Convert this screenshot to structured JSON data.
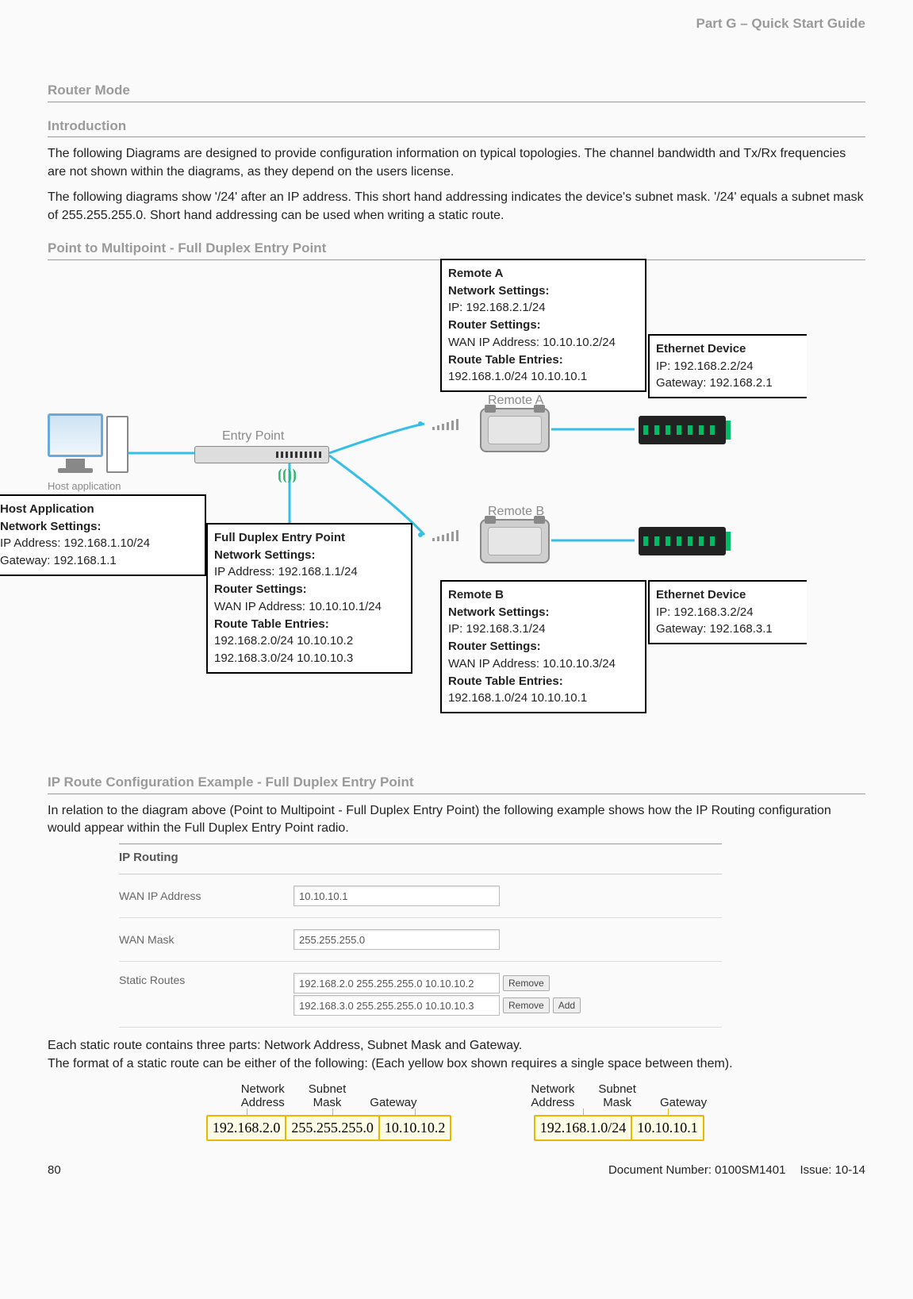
{
  "header": {
    "partLabel": "Part G – Quick Start Guide"
  },
  "sections": {
    "routerMode": "Router Mode",
    "intro": "Introduction",
    "ptmp": "Point to Multipoint - Full Duplex Entry Point",
    "ipcfg": "IP Route Configuration Example - Full Duplex Entry Point"
  },
  "paragraphs": {
    "p1": "The following Diagrams are designed to provide configuration information on typical topologies. The channel bandwidth and Tx/Rx frequencies are not shown within the diagrams, as they depend on the users license.",
    "p2": "The following diagrams show '/24' after an IP address. This short hand addressing indicates the device's subnet mask. '/24' equals a subnet mask of 255.255.255.0. Short hand addressing can be used when writing a static route.",
    "p3": "In relation to the diagram above (Point to Multipoint - Full Duplex Entry Point) the following example shows how the IP Routing configuration would appear within the Full Duplex Entry Point radio.",
    "p4a": "Each static route contains three parts: Network Address, Subnet Mask and Gateway.",
    "p4b": "The format of a static route can be either of the following: (Each yellow box shown requires a single space between them)."
  },
  "diagram": {
    "hostApp": {
      "title": "Host Application",
      "subtitle": "Network Settings:",
      "ip": "IP Address: 192.168.1.10/24",
      "gw": "Gateway: 192.168.1.1",
      "iconLabel": "Host application"
    },
    "entryPoint": {
      "label": "Entry Point",
      "boxTitle": "Full Duplex Entry Point",
      "ns": "Network Settings:",
      "ip": "IP Address: 192.168.1.1/24",
      "rs": "Router Settings:",
      "wan": "WAN IP Address: 10.10.10.1/24",
      "rte": "Route Table Entries:",
      "r1": "192.168.2.0/24 10.10.10.2",
      "r2": "192.168.3.0/24 10.10.10.3"
    },
    "remoteA": {
      "label": "Remote A",
      "title": "Remote A",
      "ns": "Network Settings:",
      "ip": "IP: 192.168.2.1/24",
      "rs": "Router Settings:",
      "wan": "WAN IP Address: 10.10.10.2/24",
      "rte": "Route Table Entries:",
      "r1": "192.168.1.0/24 10.10.10.1"
    },
    "remoteB": {
      "label": "Remote B",
      "title": "Remote B",
      "ns": "Network Settings:",
      "ip": "IP: 192.168.3.1/24",
      "rs": "Router Settings:",
      "wan": "WAN IP Address: 10.10.10.3/24",
      "rte": "Route Table Entries:",
      "r1": "192.168.1.0/24 10.10.10.1"
    },
    "ethA": {
      "title": "Ethernet Device",
      "ip": "IP: 192.168.2.2/24",
      "gw": "Gateway: 192.168.2.1"
    },
    "ethB": {
      "title": "Ethernet Device",
      "ip": "IP: 192.168.3.2/24",
      "gw": "Gateway: 192.168.3.1"
    }
  },
  "ipRouting": {
    "panelTitle": "IP Routing",
    "wanIpLabel": "WAN IP Address",
    "wanIpValue": "10.10.10.1",
    "wanMaskLabel": "WAN Mask",
    "wanMaskValue": "255.255.255.0",
    "staticLabel": "Static Routes",
    "row1": "192.168.2.0 255.255.255.0 10.10.10.2",
    "row2": "192.168.3.0 255.255.255.0 10.10.10.3",
    "removeBtn": "Remove",
    "addBtn": "Add"
  },
  "format": {
    "labels": {
      "net": "Network",
      "addr": "Address",
      "sub": "Subnet",
      "mask": "Mask",
      "gw": "Gateway"
    },
    "left": {
      "c1": "192.168.2.0",
      "c2": "255.255.255.0",
      "c3": "10.10.10.2"
    },
    "right": {
      "c1": "192.168.1.0/24",
      "c2": "10.10.10.1"
    }
  },
  "footer": {
    "page": "80",
    "docnum": "Document Number: 0100SM1401",
    "issue": "Issue: 10-14"
  }
}
